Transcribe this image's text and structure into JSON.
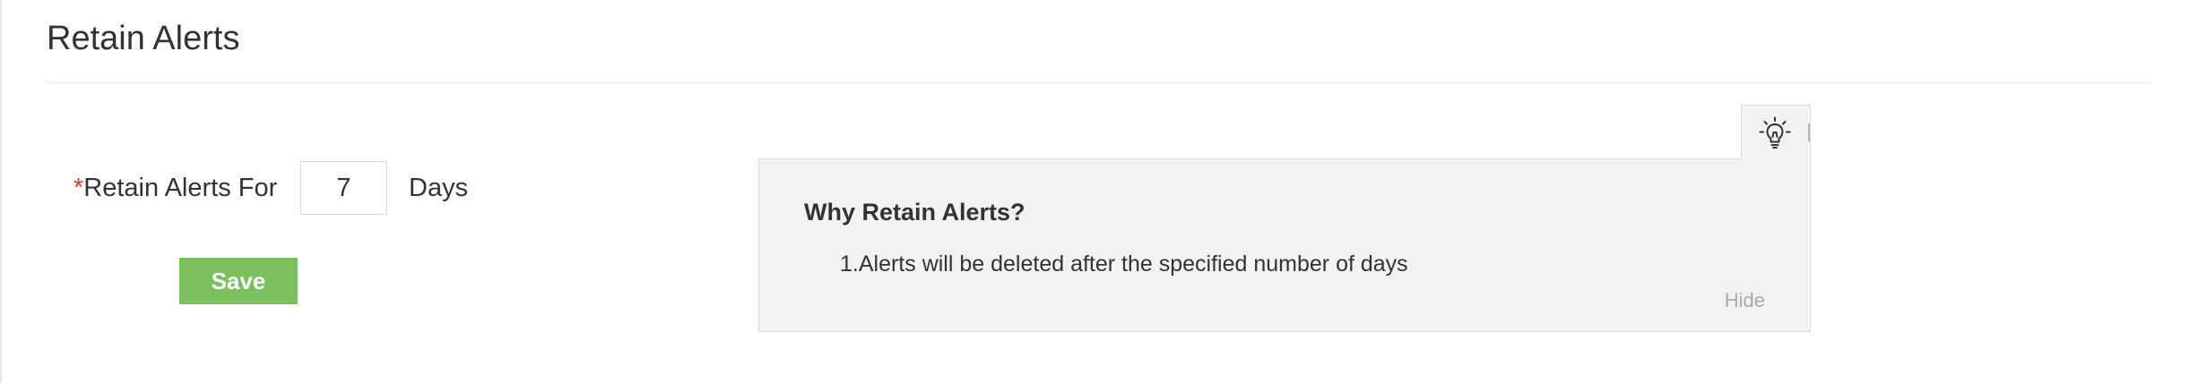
{
  "header": {
    "title": "Retain Alerts"
  },
  "form": {
    "required_marker": "*",
    "label": "Retain Alerts For",
    "days_value": "7",
    "unit": "Days",
    "save_label": "Save"
  },
  "help": {
    "tab_icon": "lightbulb-icon",
    "title": "Why Retain Alerts?",
    "items": [
      "1.Alerts will be deleted after the specified number of days"
    ],
    "hide_label": "Hide"
  },
  "colors": {
    "save_button": "#7cbf5d",
    "required_marker": "#e53935",
    "help_background": "#f1f2f2",
    "hide_link": "#aaaaaa"
  }
}
